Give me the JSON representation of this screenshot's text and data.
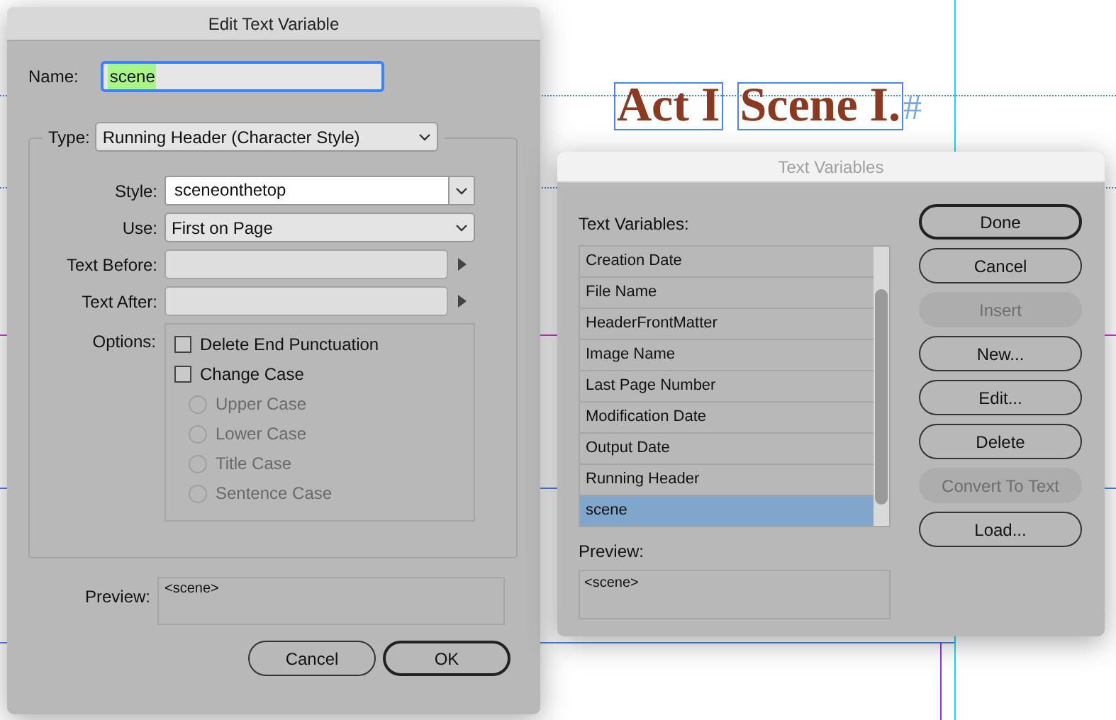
{
  "document": {
    "headings": [
      {
        "text": "Act I"
      },
      {
        "text": "Scene I."
      }
    ],
    "end_mark": "#"
  },
  "edit_dialog": {
    "title": "Edit Text Variable",
    "name": {
      "label": "Name:",
      "value": "scene"
    },
    "type": {
      "label": "Type:",
      "value": "Running Header (Character Style)"
    },
    "fields": [
      {
        "kind": "combo",
        "label": "Style:",
        "value": "sceneonthetop"
      },
      {
        "kind": "select",
        "label": "Use:",
        "value": "First on Page"
      },
      {
        "kind": "text",
        "label": "Text Before:"
      },
      {
        "kind": "text",
        "label": "Text After:"
      }
    ],
    "options": {
      "label": "Options:",
      "checkboxes": [
        {
          "label": "Delete End Punctuation",
          "checked": false
        },
        {
          "label": "Change Case",
          "checked": false
        }
      ],
      "radios": [
        {
          "label": "Upper Case",
          "selected": false,
          "disabled": true
        },
        {
          "label": "Lower Case",
          "selected": false,
          "disabled": true
        },
        {
          "label": "Title Case",
          "selected": false,
          "disabled": true
        },
        {
          "label": "Sentence Case",
          "selected": false,
          "disabled": true
        }
      ]
    },
    "preview": {
      "label": "Preview:",
      "value": "<scene>"
    },
    "buttons": [
      {
        "label": "Cancel",
        "default": false
      },
      {
        "label": "OK",
        "default": true
      }
    ]
  },
  "variables_dialog": {
    "title": "Text Variables",
    "list_label": "Text Variables:",
    "items": [
      {
        "label": "Creation Date",
        "selected": false
      },
      {
        "label": "File Name",
        "selected": false
      },
      {
        "label": "HeaderFrontMatter",
        "selected": false
      },
      {
        "label": "Image Name",
        "selected": false
      },
      {
        "label": "Last Page Number",
        "selected": false
      },
      {
        "label": "Modification Date",
        "selected": false
      },
      {
        "label": "Output Date",
        "selected": false
      },
      {
        "label": "Running Header",
        "selected": false
      },
      {
        "label": "scene",
        "selected": true
      }
    ],
    "preview": {
      "label": "Preview:",
      "value": "<scene>"
    },
    "buttons": [
      {
        "label": "Done",
        "default": true,
        "disabled": false
      },
      {
        "label": "Cancel",
        "default": false,
        "disabled": false
      },
      {
        "label": "Insert",
        "default": false,
        "disabled": true
      },
      {
        "label": "New...",
        "default": false,
        "disabled": false
      },
      {
        "label": "Edit...",
        "default": false,
        "disabled": false
      },
      {
        "label": "Delete",
        "default": false,
        "disabled": false
      },
      {
        "label": "Convert To Text",
        "default": false,
        "disabled": true
      },
      {
        "label": "Load...",
        "default": false,
        "disabled": false
      }
    ]
  }
}
